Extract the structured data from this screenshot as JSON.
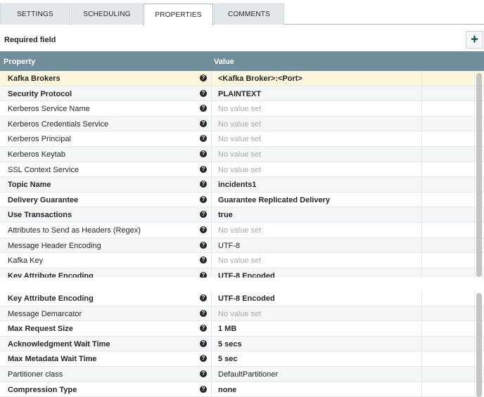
{
  "tabs": [
    {
      "label": "SETTINGS",
      "active": false
    },
    {
      "label": "SCHEDULING",
      "active": false
    },
    {
      "label": "PROPERTIES",
      "active": true
    },
    {
      "label": "COMMENTS",
      "active": false
    }
  ],
  "required_label": "Required field",
  "add_button": "+",
  "header": {
    "property": "Property",
    "value": "Value"
  },
  "help_glyph": "?",
  "top_rows": [
    {
      "name": "Kafka Brokers",
      "value": "<Kafka Broker>:<Port>",
      "required": true,
      "unset": false
    },
    {
      "name": "Security Protocol",
      "value": "PLAINTEXT",
      "required": true,
      "unset": false
    },
    {
      "name": "Kerberos Service Name",
      "value": "No value set",
      "required": false,
      "unset": true
    },
    {
      "name": "Kerberos Credentials Service",
      "value": "No value set",
      "required": false,
      "unset": true
    },
    {
      "name": "Kerberos Principal",
      "value": "No value set",
      "required": false,
      "unset": true
    },
    {
      "name": "Kerberos Keytab",
      "value": "No value set",
      "required": false,
      "unset": true
    },
    {
      "name": "SSL Context Service",
      "value": "No value set",
      "required": false,
      "unset": true
    },
    {
      "name": "Topic Name",
      "value": "incidents1",
      "required": true,
      "unset": false
    },
    {
      "name": "Delivery Guarantee",
      "value": "Guarantee Replicated Delivery",
      "required": true,
      "unset": false
    },
    {
      "name": "Use Transactions",
      "value": "true",
      "required": true,
      "unset": false
    },
    {
      "name": "Attributes to Send as Headers (Regex)",
      "value": "No value set",
      "required": false,
      "unset": true
    },
    {
      "name": "Message Header Encoding",
      "value": "UTF-8",
      "required": false,
      "unset": false
    },
    {
      "name": "Kafka Key",
      "value": "No value set",
      "required": false,
      "unset": true
    },
    {
      "name": "Key Attribute Encoding",
      "value": "UTF-8 Encoded",
      "required": true,
      "unset": false
    }
  ],
  "bottom_rows": [
    {
      "name": "Key Attribute Encoding",
      "value": "UTF-8 Encoded",
      "required": true,
      "unset": false
    },
    {
      "name": "Message Demarcator",
      "value": "No value set",
      "required": false,
      "unset": true
    },
    {
      "name": "Max Request Size",
      "value": "1 MB",
      "required": true,
      "unset": false
    },
    {
      "name": "Acknowledgment Wait Time",
      "value": "5 secs",
      "required": true,
      "unset": false
    },
    {
      "name": "Max Metadata Wait Time",
      "value": "5 sec",
      "required": true,
      "unset": false
    },
    {
      "name": "Partitioner class",
      "value": "DefaultPartitioner",
      "required": false,
      "unset": false
    },
    {
      "name": "Compression Type",
      "value": "none",
      "required": true,
      "unset": false
    }
  ]
}
